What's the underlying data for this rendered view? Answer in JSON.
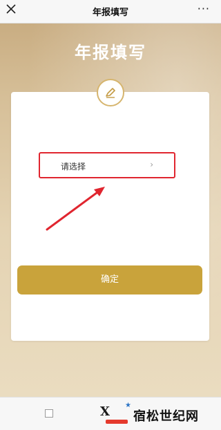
{
  "header": {
    "title": "年报填写",
    "more": "···"
  },
  "hero": {
    "title": "年报填写"
  },
  "form": {
    "select_placeholder": "请选择",
    "select_chevron": "›"
  },
  "actions": {
    "confirm_label": "确定"
  },
  "footer": {
    "logo_letter": "X",
    "brand_text": "宿松世纪网"
  },
  "colors": {
    "accent_gold": "#c9a33b",
    "highlight_red": "#e0252f",
    "logo_blue": "#2b73c5"
  },
  "icons": {
    "close": "close-icon",
    "more": "more-icon",
    "edit": "pencil-icon"
  }
}
